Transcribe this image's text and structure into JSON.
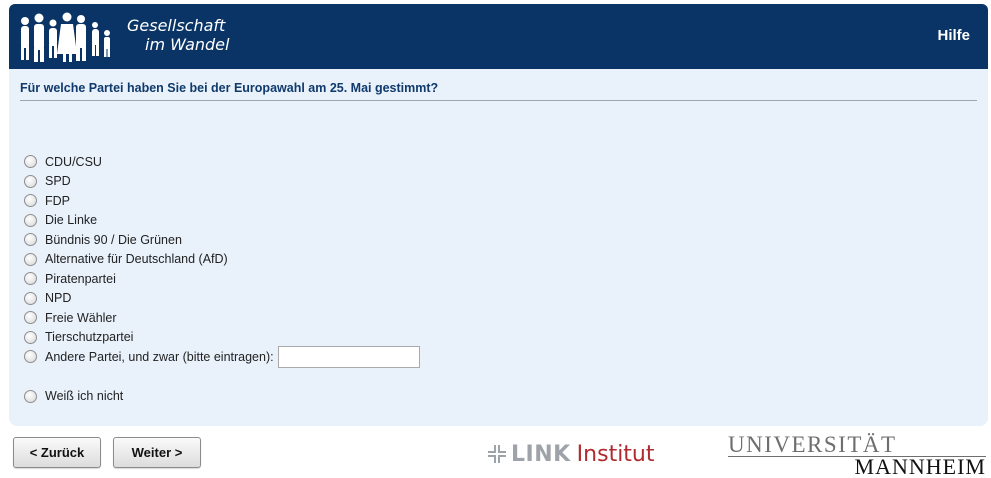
{
  "header": {
    "brand_line1": "Gesellschaft",
    "brand_line2": "im Wandel",
    "help_label": "Hilfe",
    "bg_color": "#0b3466"
  },
  "question": {
    "text": "Für welche Partei haben Sie bei der Europawahl am 25. Mai gestimmt?"
  },
  "options": [
    {
      "label": "CDU/CSU"
    },
    {
      "label": "SPD"
    },
    {
      "label": "FDP"
    },
    {
      "label": "Die Linke"
    },
    {
      "label": "Bündnis 90 / Die Grünen"
    },
    {
      "label": "Alternative für Deutschland (AfD)"
    },
    {
      "label": "Piratenpartei"
    },
    {
      "label": "NPD"
    },
    {
      "label": "Freie Wähler"
    },
    {
      "label": "Tierschutzpartei"
    },
    {
      "label": "Andere Partei, und zwar (bitte eintragen):",
      "input_value": ""
    },
    {
      "label": "Weiß ich nicht"
    }
  ],
  "nav": {
    "back_label": "< Zurück",
    "next_label": "Weiter >"
  },
  "logos": {
    "link_word": "LINK",
    "institut_word": "Institut",
    "uni_line1": "UNIVERSITÄT",
    "uni_line2": "MANNHEIM"
  },
  "colors": {
    "panel_bg": "#e9f1fb",
    "question_text": "#103a6c",
    "link_red": "#b02a2f"
  }
}
